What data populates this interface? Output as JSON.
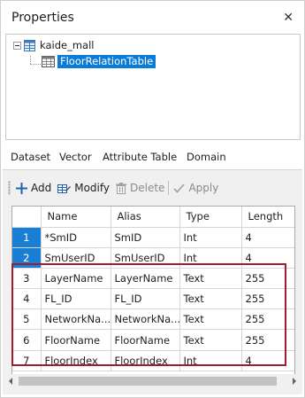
{
  "panel": {
    "title": "Properties",
    "close_glyph": "✕"
  },
  "tree": {
    "root": {
      "label": "kaide_mall",
      "icon": "database-icon"
    },
    "child": {
      "label": "FloorRelationTable",
      "icon": "table-icon",
      "selected": true
    }
  },
  "tabs": [
    {
      "label": "Dataset"
    },
    {
      "label": "Vector"
    },
    {
      "label": "Attribute Table",
      "active": true
    },
    {
      "label": "Domain"
    }
  ],
  "toolbar": {
    "add_label": "Add",
    "modify_label": "Modify",
    "delete_label": "Delete",
    "apply_label": "Apply"
  },
  "grid": {
    "columns": [
      "Name",
      "Alias",
      "Type",
      "Length"
    ],
    "rows": [
      {
        "num": "1",
        "name": "*SmID",
        "alias": "SmID",
        "type": "Int",
        "length": "4"
      },
      {
        "num": "2",
        "name": "SmUserID",
        "alias": "SmUserID",
        "type": "Int",
        "length": "4"
      },
      {
        "num": "3",
        "name": "LayerName",
        "alias": "LayerName",
        "type": "Text",
        "length": "255"
      },
      {
        "num": "4",
        "name": "FL_ID",
        "alias": "FL_ID",
        "type": "Text",
        "length": "255"
      },
      {
        "num": "5",
        "name": "NetworkNa...",
        "alias": "NetworkNa...",
        "type": "Text",
        "length": "255"
      },
      {
        "num": "6",
        "name": "FloorName",
        "alias": "FloorName",
        "type": "Text",
        "length": "255"
      },
      {
        "num": "7",
        "name": "FloorIndex",
        "alias": "FloorIndex",
        "type": "Int",
        "length": "4"
      }
    ]
  },
  "colors": {
    "selection": "#0a7bd6",
    "highlight_box": "#a11c2e",
    "add_icon": "#1f62b5"
  }
}
